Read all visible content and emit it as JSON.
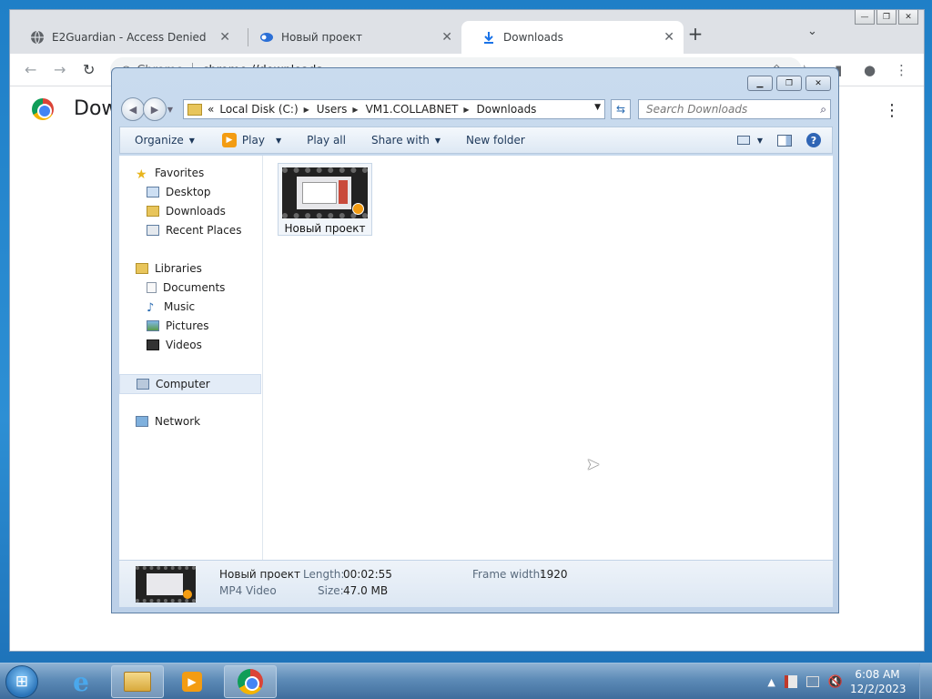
{
  "chrome": {
    "tabs": [
      {
        "title": "E2Guardian - Access Denied",
        "icon": "globe-icon"
      },
      {
        "title": "Новый проект",
        "icon": "project-icon"
      },
      {
        "title": "Downloads",
        "icon": "download-icon"
      }
    ],
    "active_tab": 2,
    "omnibox": {
      "site_label": "Chrome",
      "url": "chrome://downloads"
    },
    "page_title": "Downloads"
  },
  "explorer": {
    "address": {
      "prefix": "«",
      "crumbs": [
        "Local Disk (C:)",
        "Users",
        "VM1.COLLABNET",
        "Downloads"
      ]
    },
    "search_placeholder": "Search Downloads",
    "commands": {
      "organize": "Organize",
      "play": "Play",
      "play_all": "Play all",
      "share_with": "Share with",
      "new_folder": "New folder"
    },
    "nav": {
      "favorites": "Favorites",
      "desktop": "Desktop",
      "downloads": "Downloads",
      "recent_places": "Recent Places",
      "libraries": "Libraries",
      "documents": "Documents",
      "music": "Music",
      "pictures": "Pictures",
      "videos": "Videos",
      "computer": "Computer",
      "network": "Network"
    },
    "files": [
      {
        "name": "Новый проект",
        "type": "video-thumbnail"
      }
    ],
    "details": {
      "name": "Новый проект",
      "type": "MP4 Video",
      "length_label": "Length:",
      "length": "00:02:55",
      "size_label": "Size:",
      "size": "47.0 MB",
      "frame_width_label": "Frame width:",
      "frame_width": "1920"
    }
  },
  "taskbar": {
    "apps": [
      "start-orb",
      "internet-explorer",
      "windows-explorer",
      "media-player",
      "google-chrome"
    ],
    "time": "6:08 AM",
    "date": "12/2/2023"
  }
}
